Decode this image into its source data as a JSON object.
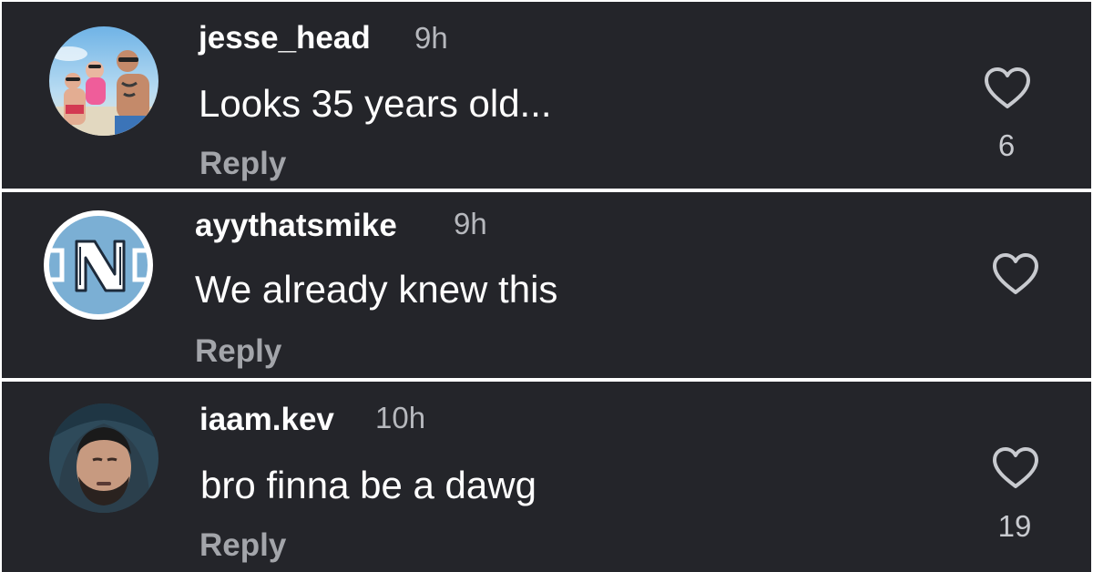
{
  "comments": [
    {
      "username": "jesse_head",
      "time": "9h",
      "text": "Looks 35 years old...",
      "reply_label": "Reply",
      "like_count": "6",
      "avatar_icon": "beach-family-photo"
    },
    {
      "username": "ayythatsmike",
      "time": "9h",
      "text": "We already knew this",
      "reply_label": "Reply",
      "like_count": "",
      "avatar_icon": "unc-logo"
    },
    {
      "username": "iaam.kev",
      "time": "10h",
      "text": "bro finna be a dawg",
      "reply_label": "Reply",
      "like_count": "19",
      "avatar_icon": "selfie-photo"
    }
  ],
  "colors": {
    "background": "#24252a",
    "username": "#ffffff",
    "meta": "#b6b8bd",
    "reply": "#a3a5aa",
    "unc_blue": "#7bafd4"
  }
}
